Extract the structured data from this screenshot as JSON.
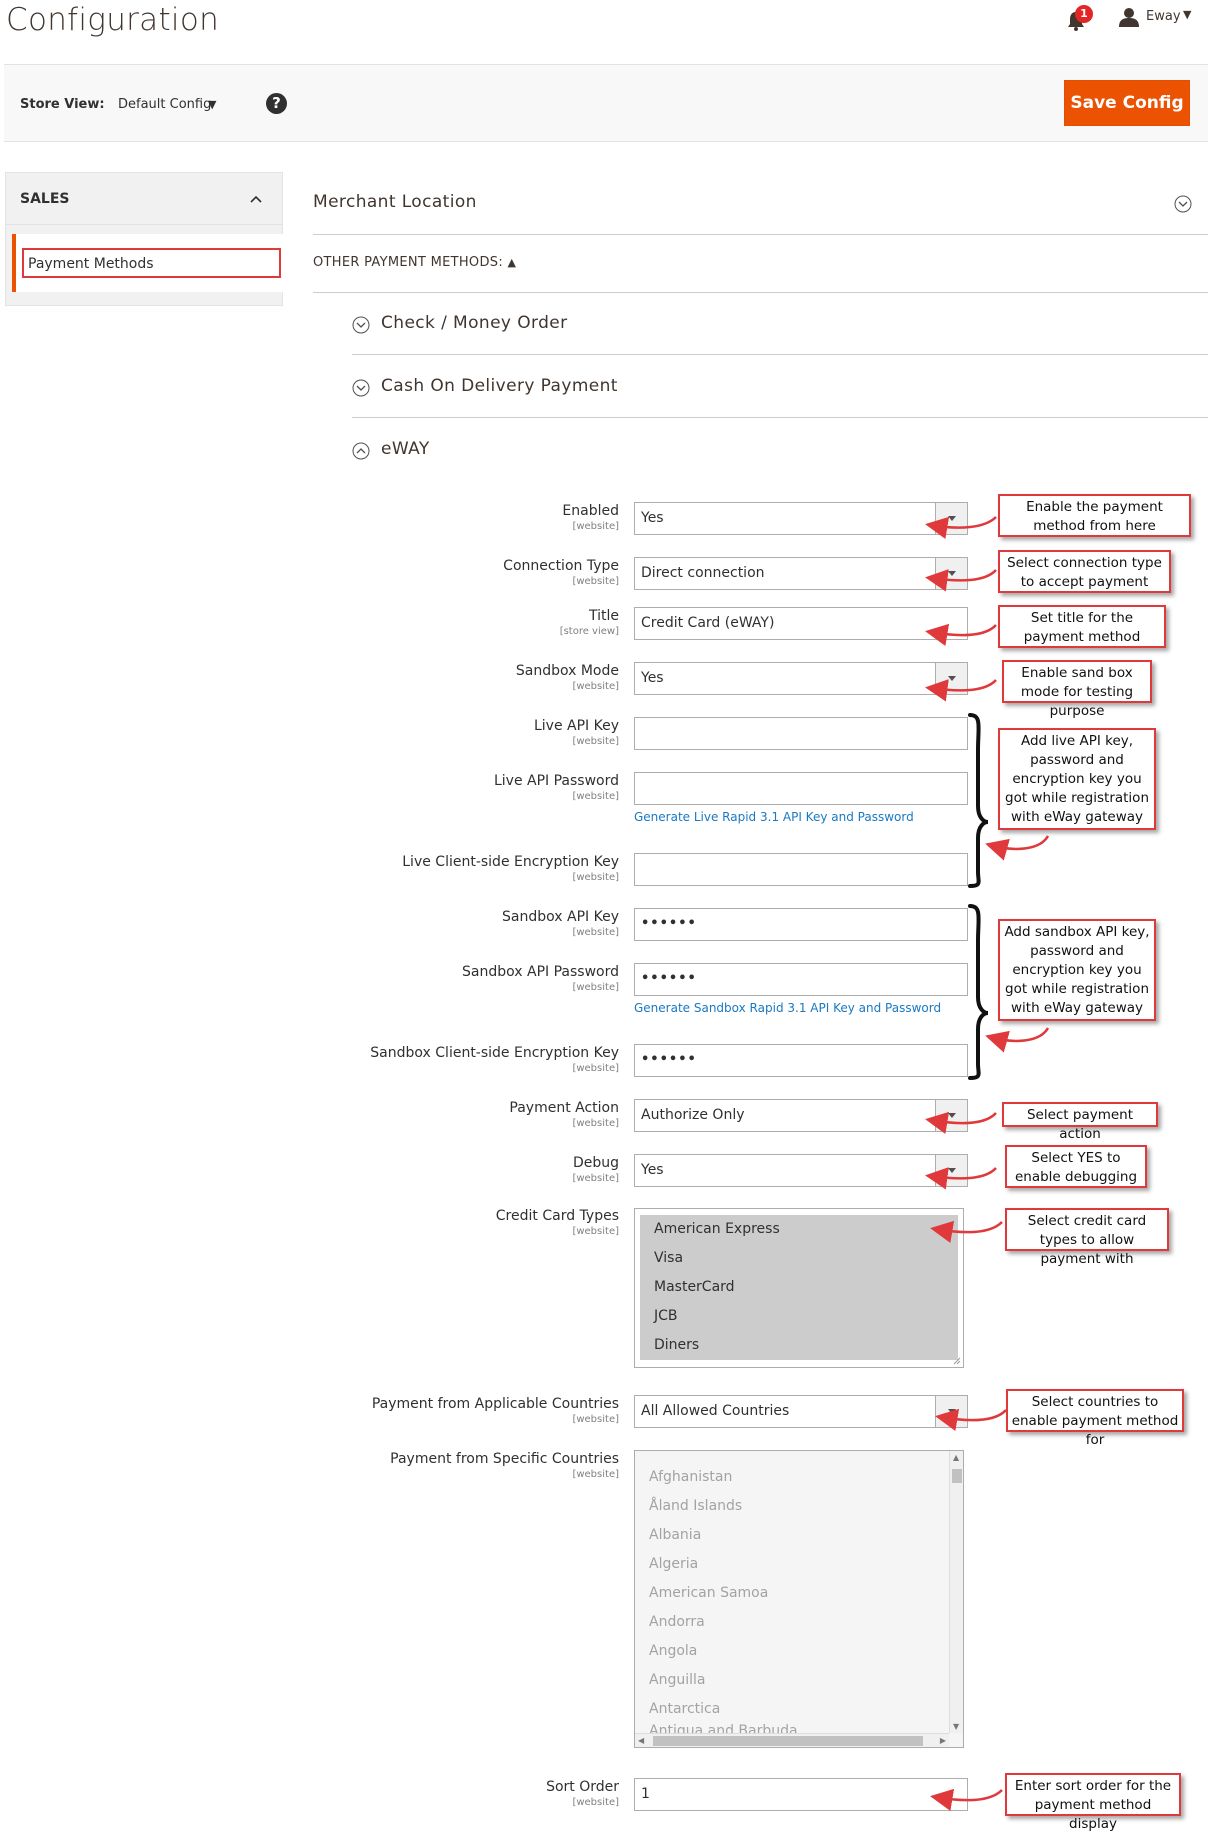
{
  "header": {
    "title": "Configuration",
    "notification_count": "1",
    "user_name": "Eway"
  },
  "store_bar": {
    "label": "Store View:",
    "value": "Default Config",
    "save_label": "Save Config"
  },
  "sidebar": {
    "group_title": "SALES",
    "items": [
      {
        "label": "Payment Methods"
      }
    ]
  },
  "sections": {
    "merchant_location": "Merchant Location",
    "other_payment_methods": "OTHER PAYMENT METHODS:",
    "check_money_order": "Check / Money Order",
    "cash_on_delivery": "Cash On Delivery Payment",
    "eway": "eWAY"
  },
  "form": {
    "enabled": {
      "label": "Enabled",
      "scope": "[website]",
      "value": "Yes"
    },
    "connection_type": {
      "label": "Connection Type",
      "scope": "[website]",
      "value": "Direct connection"
    },
    "title": {
      "label": "Title",
      "scope": "[store view]",
      "value": "Credit Card (eWAY)"
    },
    "sandbox_mode": {
      "label": "Sandbox Mode",
      "scope": "[website]",
      "value": "Yes"
    },
    "live_api_key": {
      "label": "Live API Key",
      "scope": "[website]",
      "value": ""
    },
    "live_api_password": {
      "label": "Live API Password",
      "scope": "[website]",
      "value": ""
    },
    "live_link": "Generate Live Rapid 3.1 API Key and Password",
    "live_encryption_key": {
      "label": "Live Client-side Encryption Key",
      "scope": "[website]",
      "value": ""
    },
    "sandbox_api_key": {
      "label": "Sandbox API Key",
      "scope": "[website]",
      "value": "••••••"
    },
    "sandbox_api_password": {
      "label": "Sandbox API Password",
      "scope": "[website]",
      "value": "••••••"
    },
    "sandbox_link": "Generate Sandbox Rapid 3.1 API Key and Password",
    "sandbox_encryption_key": {
      "label": "Sandbox Client-side Encryption Key",
      "scope": "[website]",
      "value": "••••••"
    },
    "payment_action": {
      "label": "Payment Action",
      "scope": "[website]",
      "value": "Authorize Only"
    },
    "debug": {
      "label": "Debug",
      "scope": "[website]",
      "value": "Yes"
    },
    "credit_card_types": {
      "label": "Credit Card Types",
      "scope": "[website]",
      "options": [
        "American Express",
        "Visa",
        "MasterCard",
        "JCB",
        "Diners"
      ]
    },
    "applicable_countries": {
      "label": "Payment from Applicable Countries",
      "scope": "[website]",
      "value": "All Allowed Countries"
    },
    "specific_countries": {
      "label": "Payment from Specific Countries",
      "scope": "[website]",
      "options": [
        "Afghanistan",
        "Åland Islands",
        "Albania",
        "Algeria",
        "American Samoa",
        "Andorra",
        "Angola",
        "Anguilla",
        "Antarctica",
        "Antigua and Barbuda"
      ]
    },
    "sort_order": {
      "label": "Sort Order",
      "scope": "[website]",
      "value": "1"
    }
  },
  "annotations": [
    "Enable the payment method from here",
    "Select connection type to accept payment",
    "Set title for the payment method",
    "Enable sand box mode for testing purpose",
    "Add live API key, password and encryption key you got while registration with eWay gateway",
    "Add sandbox API key, password and encryption key you got while registration with eWay gateway",
    "Select payment action",
    "Select YES to enable debugging",
    "Select credit card types to allow payment with",
    "Select countries to enable payment method for",
    "Enter sort order for the payment method display"
  ],
  "colors": {
    "accent": "#eb5202",
    "annotation_border": "#e0393b",
    "link": "#1979c3",
    "badge": "#e22626"
  }
}
